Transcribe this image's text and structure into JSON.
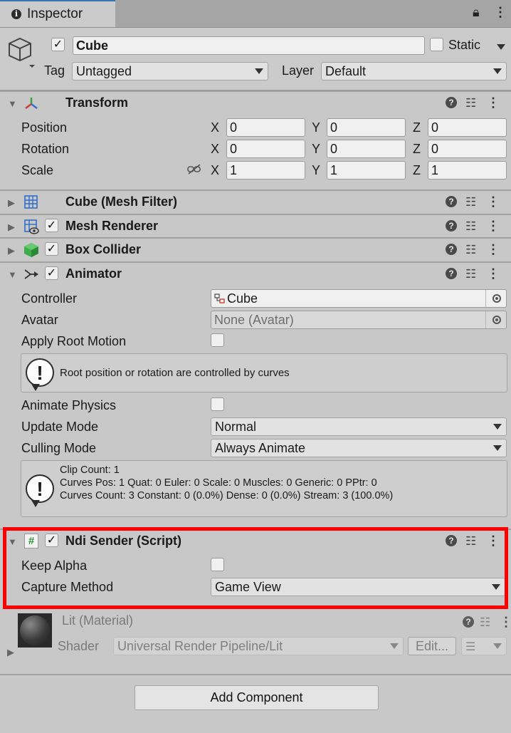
{
  "tab": {
    "title": "Inspector"
  },
  "object": {
    "name": "Cube",
    "static_label": "Static",
    "tag_label": "Tag",
    "tag_value": "Untagged",
    "layer_label": "Layer",
    "layer_value": "Default",
    "active_checked": true
  },
  "transform": {
    "title": "Transform",
    "rows": [
      {
        "label": "Position",
        "x": "0",
        "y": "0",
        "z": "0"
      },
      {
        "label": "Rotation",
        "x": "0",
        "y": "0",
        "z": "0"
      },
      {
        "label": "Scale",
        "x": "1",
        "y": "1",
        "z": "1"
      }
    ],
    "axes": {
      "x": "X",
      "y": "Y",
      "z": "Z"
    }
  },
  "components": {
    "mesh_filter": "Cube (Mesh Filter)",
    "mesh_renderer": "Mesh Renderer",
    "box_collider": "Box Collider"
  },
  "animator": {
    "title": "Animator",
    "controller_label": "Controller",
    "controller_value": "Cube",
    "avatar_label": "Avatar",
    "avatar_value": "None (Avatar)",
    "apply_root_label": "Apply Root Motion",
    "root_help": "Root position or rotation are controlled by curves",
    "animate_physics_label": "Animate Physics",
    "update_mode_label": "Update Mode",
    "update_mode_value": "Normal",
    "culling_mode_label": "Culling Mode",
    "culling_mode_value": "Always Animate",
    "info_line1": "Clip Count: 1",
    "info_line2": "Curves Pos: 1 Quat: 0 Euler: 0 Scale: 0 Muscles: 0 Generic: 0 PPtr: 0",
    "info_line3": "Curves Count: 3 Constant: 0 (0.0%) Dense: 0 (0.0%) Stream: 3 (100.0%)"
  },
  "ndi": {
    "title": "Ndi Sender (Script)",
    "keep_alpha_label": "Keep Alpha",
    "capture_label": "Capture Method",
    "capture_value": "Game View"
  },
  "material": {
    "name": "Lit (Material)",
    "shader_label": "Shader",
    "shader_value": "Universal Render Pipeline/Lit",
    "edit_label": "Edit..."
  },
  "add_component": "Add Component",
  "colors": {
    "highlight": "#ff0000",
    "tab_accent": "#3a72b0"
  }
}
